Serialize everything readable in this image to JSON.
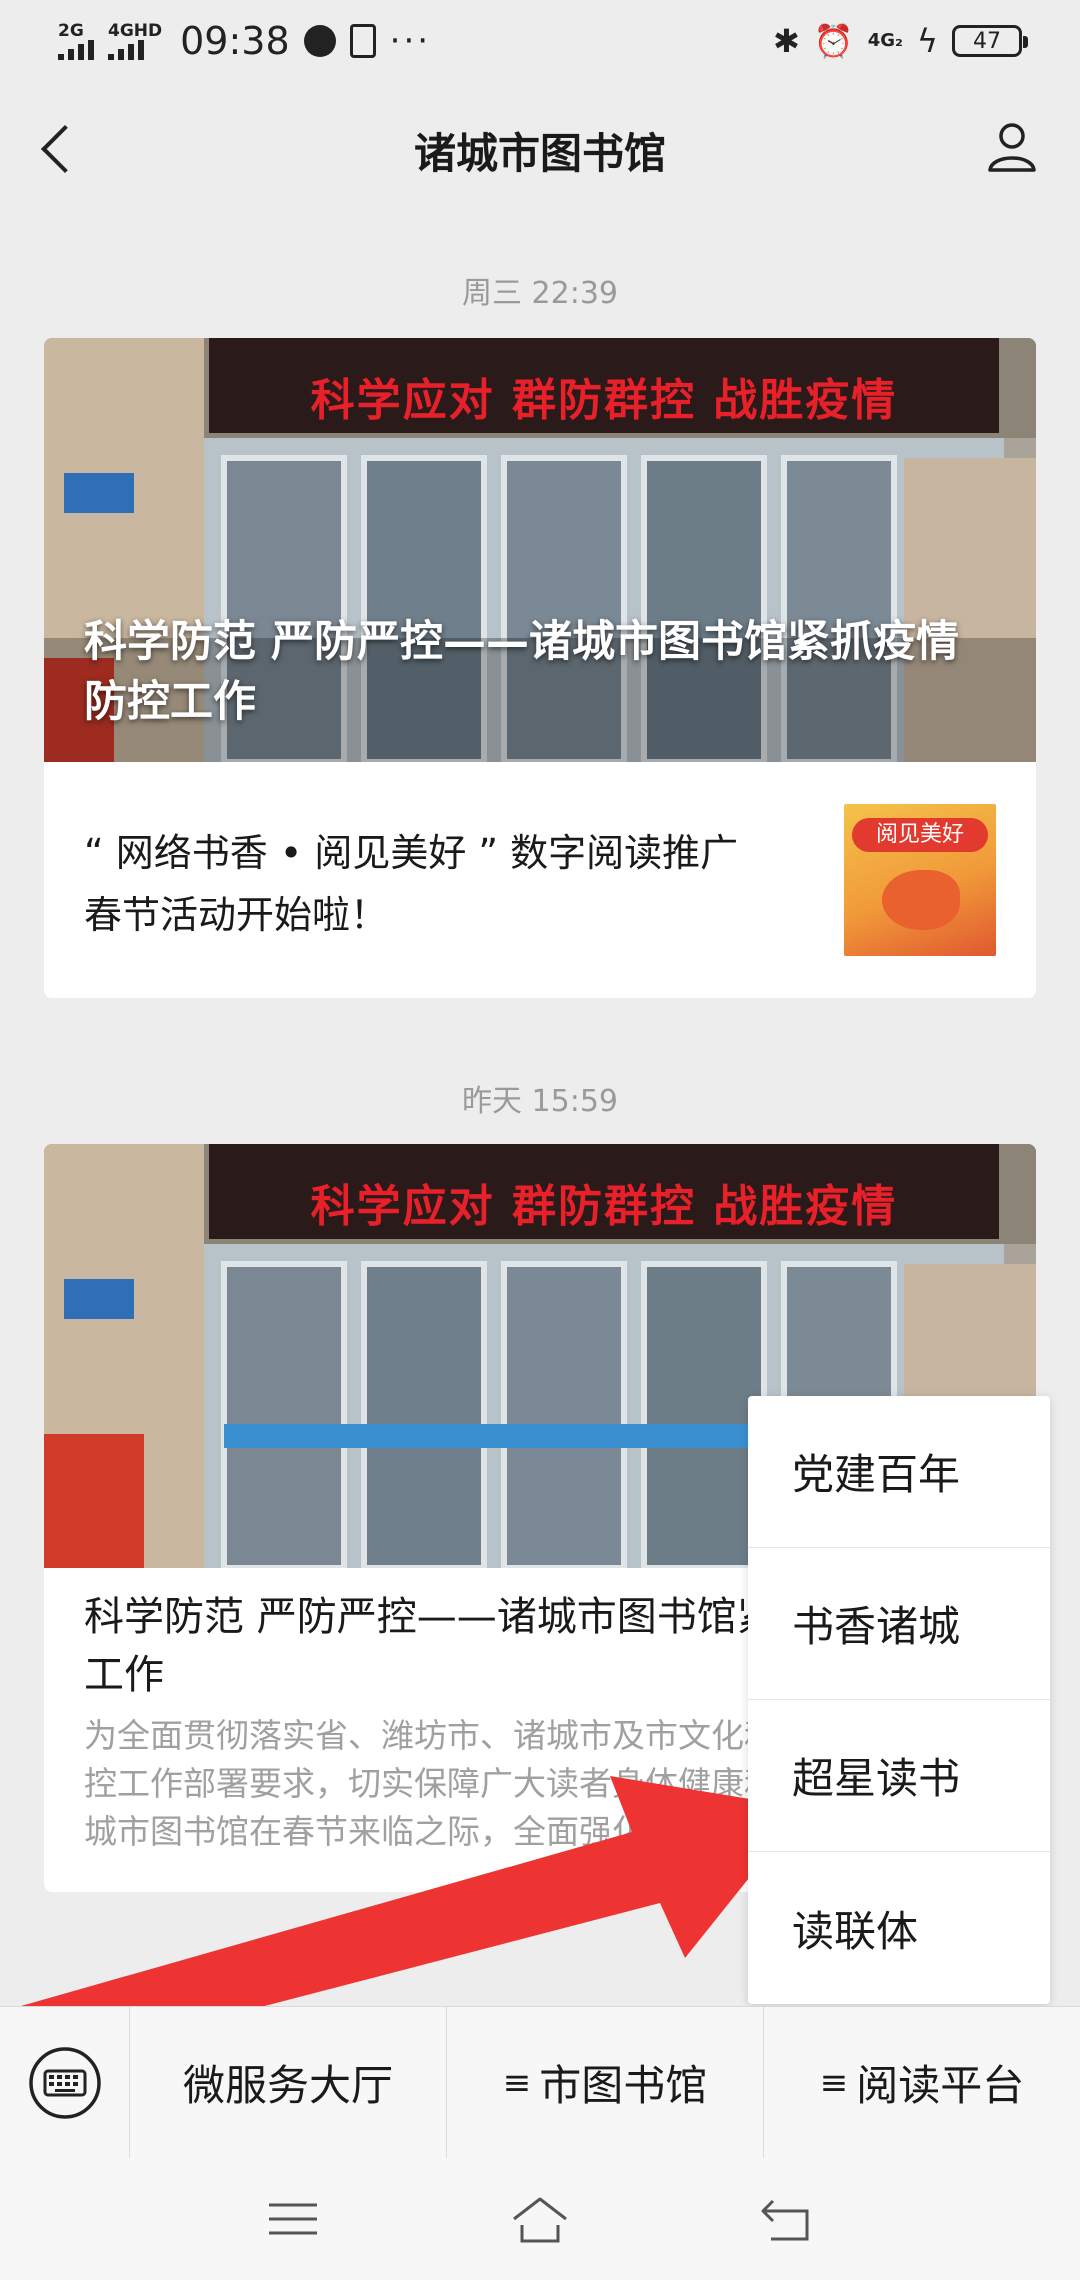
{
  "status_bar": {
    "signal_1": "2G",
    "signal_2": "4GHD",
    "time": "09:38",
    "more": "···",
    "network": "4G₂",
    "battery": "47"
  },
  "header": {
    "title": "诸城市图书馆"
  },
  "messages": [
    {
      "time": "周三 22:39",
      "cover_title": "科学防范 严防严控——诸城市图书馆紧抓疫情防控工作",
      "cover_banner": "科学应对 群防群控 战胜疫情",
      "sub_title": "“ 网络书香 • 阅见美好 ” 数字阅读推广春节活动开始啦！",
      "thumb_text": "阅见美好"
    },
    {
      "time": "昨天 15:59",
      "cover_banner": "科学应对 群防群控 战胜疫情",
      "title": "科学防范 严防严控——诸城市图书馆紧抓疫情防控工作",
      "digest": "为全面贯彻落实省、潍坊市、诸城市及市文化和旅游局疫情防控工作部署要求，切实保障广大读者身体健康和生命安全，诸城市图书馆在春节来临之际，全面强化防控和读者服务工作。"
    }
  ],
  "popup_menu": {
    "items": [
      "党建百年",
      "书香诸城",
      "超星读书",
      "读联体"
    ]
  },
  "menu_bar": {
    "items": [
      {
        "label": "微服务大厅",
        "has_submenu": false
      },
      {
        "label": "市图书馆",
        "has_submenu": true
      },
      {
        "label": "阅读平台",
        "has_submenu": true
      }
    ],
    "submenu_symbol": "≡"
  },
  "colors": {
    "background": "#ededed",
    "annotation_arrow": "#ee3333",
    "banner_text": "#e8202a"
  }
}
